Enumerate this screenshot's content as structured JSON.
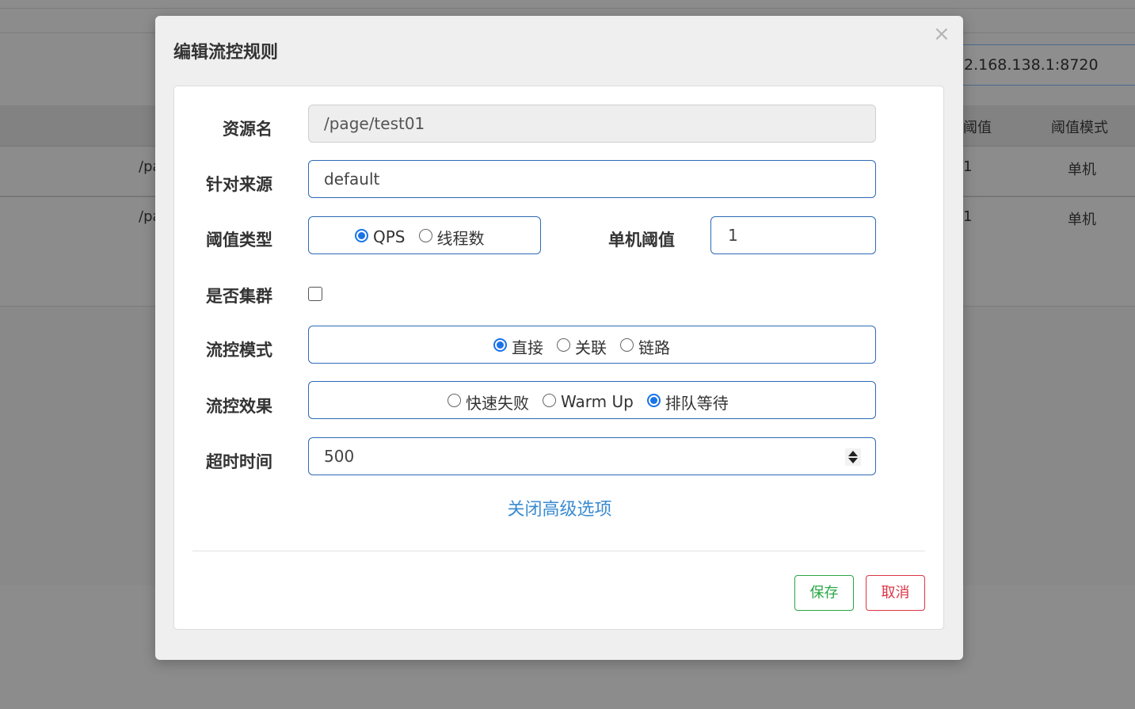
{
  "background": {
    "ip_fragment": "2.168.138.1:8720",
    "table_headers": [
      "阈值",
      "阈值模式"
    ],
    "rows": [
      {
        "resource_fragment": "/pa",
        "threshold_fragment": "1",
        "mode": "单机"
      },
      {
        "resource_fragment": "/pa",
        "threshold_fragment": "1",
        "mode": "单机"
      }
    ]
  },
  "modal": {
    "title": "编辑流控规则",
    "close_symbol": "×",
    "fields": {
      "resource": {
        "label": "资源名",
        "value": "/page/test01"
      },
      "origin": {
        "label": "针对来源",
        "value": "default"
      },
      "threshold_type": {
        "label": "阈值类型",
        "options": [
          "QPS",
          "线程数"
        ],
        "selected": "QPS"
      },
      "single_threshold": {
        "label": "单机阈值",
        "value": "1"
      },
      "cluster": {
        "label": "是否集群",
        "checked": false
      },
      "control_mode": {
        "label": "流控模式",
        "options": [
          "直接",
          "关联",
          "链路"
        ],
        "selected": "直接"
      },
      "control_effect": {
        "label": "流控效果",
        "options": [
          "快速失败",
          "Warm Up",
          "排队等待"
        ],
        "selected": "排队等待"
      },
      "timeout": {
        "label": "超时时间",
        "value": "500"
      }
    },
    "advanced_link": "关闭高级选项",
    "buttons": {
      "save": "保存",
      "cancel": "取消"
    }
  }
}
